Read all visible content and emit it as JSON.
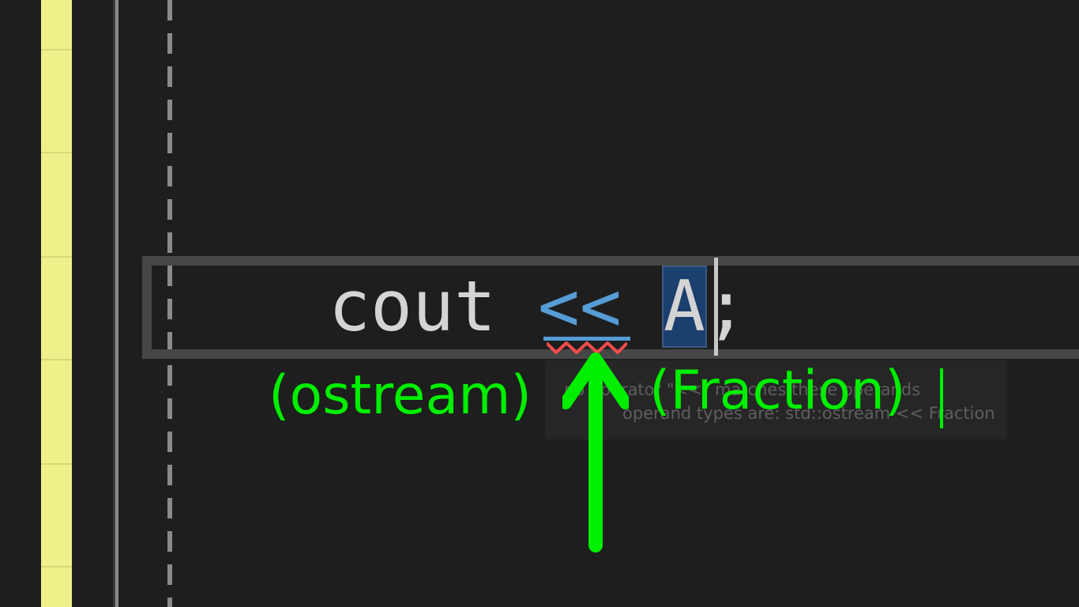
{
  "editor": {
    "code": {
      "identifier": "cout",
      "operator": "<<",
      "selected_token": "A",
      "terminator": ";"
    },
    "tooltip": {
      "line1": "no operator \"<<\" matches these operands",
      "line2": "operand types are: std::ostream << Fraction"
    }
  },
  "annotations": {
    "left_type": "(ostream)",
    "right_type": "(Fraction)"
  },
  "colors": {
    "background": "#1e1e1e",
    "keyword_operator": "#569cd6",
    "selection": "#1b3f6e",
    "annotation": "#00ee00",
    "error_squiggle": "#f14c4c",
    "gutter_marker": "#eef18a"
  }
}
